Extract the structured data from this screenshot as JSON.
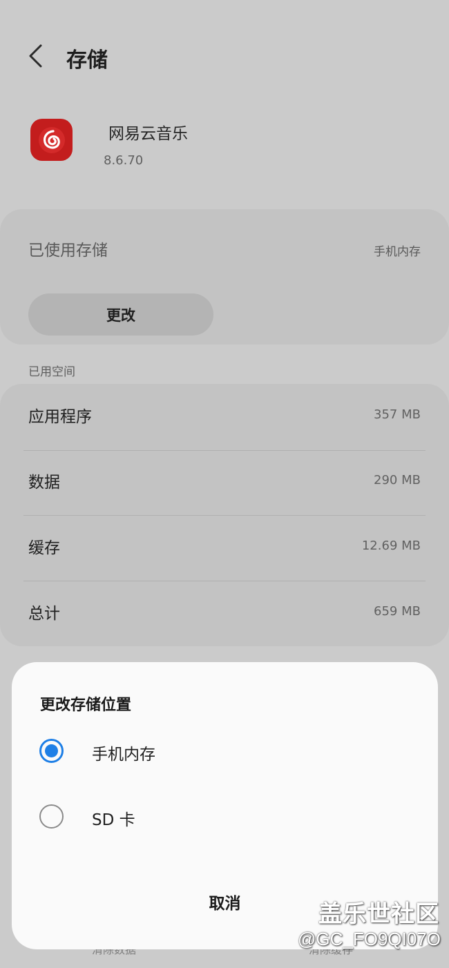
{
  "header": {
    "title": "存储"
  },
  "app": {
    "name": "网易云音乐",
    "version": "8.6.70"
  },
  "storage_used": {
    "label": "已使用存储",
    "location": "手机内存",
    "change_button": "更改"
  },
  "usage": {
    "section_label": "已用空间",
    "rows": [
      {
        "label": "应用程序",
        "value": "357 MB"
      },
      {
        "label": "数据",
        "value": "290 MB"
      },
      {
        "label": "缓存",
        "value": "12.69 MB"
      },
      {
        "label": "总计",
        "value": "659 MB"
      }
    ]
  },
  "dialog": {
    "title": "更改存储位置",
    "options": [
      {
        "label": "手机内存",
        "selected": true
      },
      {
        "label": "SD 卡",
        "selected": false
      }
    ],
    "cancel": "取消"
  },
  "bottom_buttons": {
    "clear_data": "清除数据",
    "clear_cache": "清除缓存"
  },
  "watermark": {
    "title": "盖乐世社区",
    "handle": "@GC_FO9QI07O"
  },
  "colors": {
    "accent": "#1e7fe6",
    "app_icon": "#c31d1d"
  }
}
